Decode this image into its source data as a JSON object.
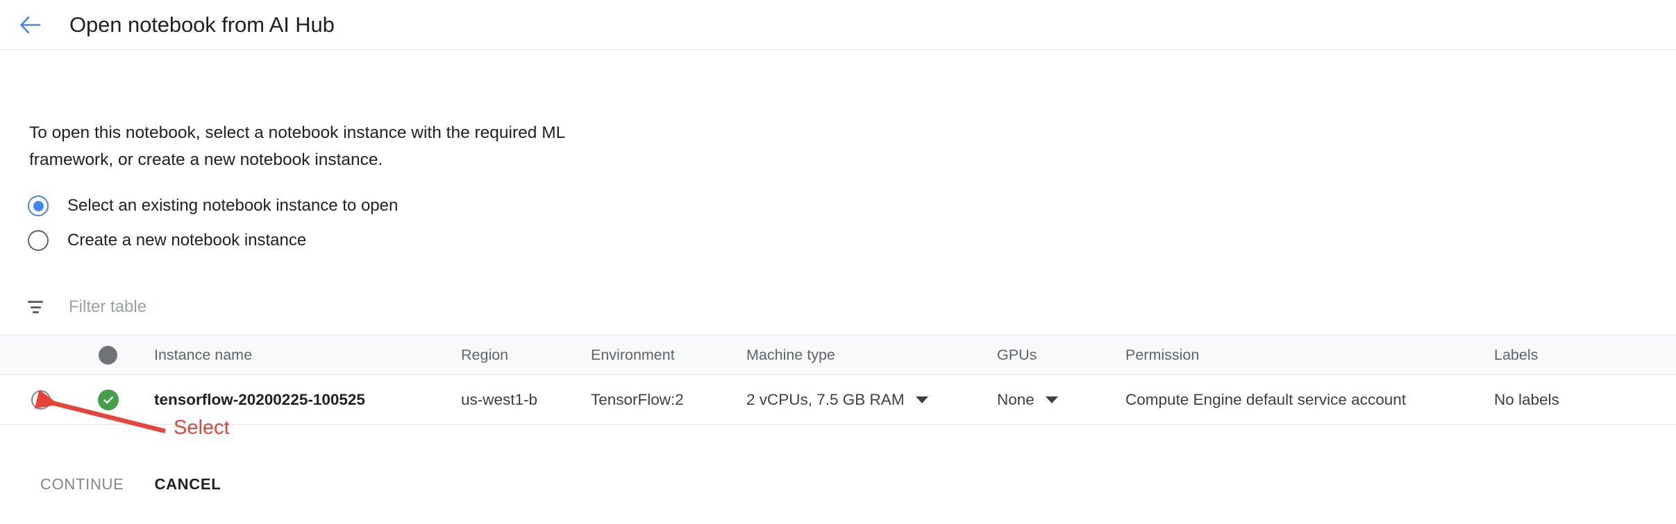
{
  "header": {
    "back_icon": "arrow-left-icon",
    "title": "Open notebook from AI Hub"
  },
  "description": "To open this notebook, select a notebook instance with the required ML\nframework, or create a new notebook instance.",
  "radio_options": [
    {
      "label": "Select an existing notebook instance to open",
      "selected": true
    },
    {
      "label": "Create a new notebook instance",
      "selected": false
    }
  ],
  "filter": {
    "icon": "filter-icon",
    "placeholder": "Filter table",
    "value": ""
  },
  "table": {
    "columns": [
      "",
      "",
      "Instance name",
      "Region",
      "Environment",
      "Machine type",
      "GPUs",
      "Permission",
      "Labels"
    ],
    "rows": [
      {
        "selected": false,
        "status": "ok",
        "instance_name": "tensorflow-20200225-100525",
        "region": "us-west1-b",
        "environment": "TensorFlow:2",
        "machine_type": "2 vCPUs, 7.5 GB RAM",
        "gpus": "None",
        "permission": "Compute Engine default service account",
        "labels": "No labels"
      }
    ]
  },
  "buttons": {
    "continue": "CONTINUE",
    "cancel": "CANCEL"
  },
  "annotation": {
    "label": "Select",
    "color": "#ea4335"
  },
  "colors": {
    "accent_blue": "#4285f4",
    "status_green": "#43a047",
    "header_bg": "#f8f9fa",
    "muted_text": "#5f6368",
    "annotation_red": "#ea4335"
  }
}
